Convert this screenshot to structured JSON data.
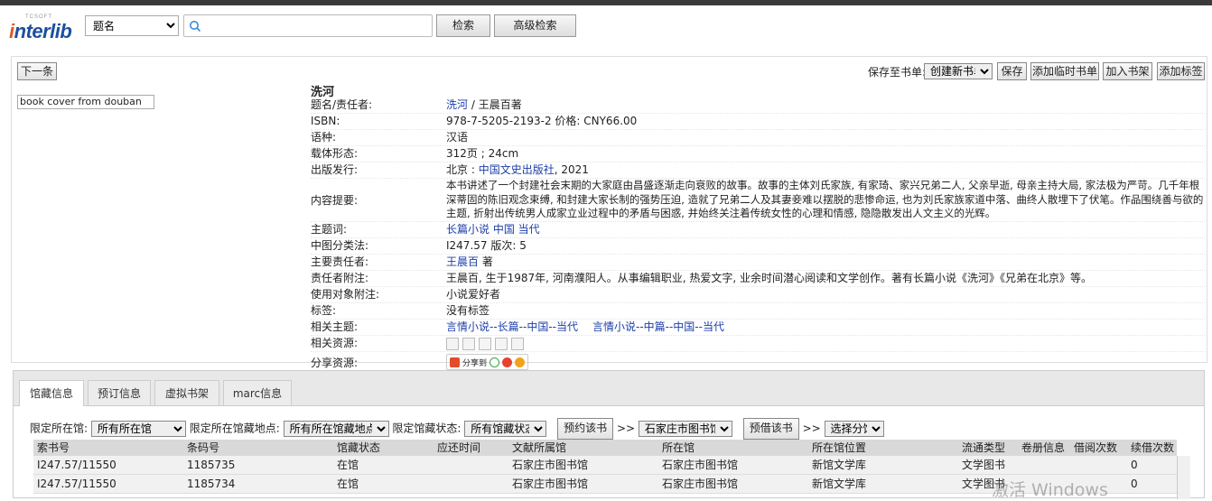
{
  "logo": {
    "tcsoft": "TCSOFT",
    "text_i": "i",
    "text_rest": "nterlib"
  },
  "search": {
    "field": "题名",
    "button": "检索",
    "advanced": "高级检索"
  },
  "toolbar": {
    "next": "下一条",
    "save_to_label": "保存至书单:",
    "booklist_select": "创建新书单",
    "save": "保存",
    "add_temp": "添加临时书单",
    "add_shelf": "加入书架",
    "add_tag": "添加标签"
  },
  "cover_alt": "book cover from douban",
  "book": {
    "title": "洗河",
    "fields": [
      {
        "label": "题名/责任者:",
        "link": "洗河",
        "text": " / 王晨百著"
      },
      {
        "label": "ISBN:",
        "text": "978-7-5205-2193-2 价格:   CNY66.00"
      },
      {
        "label": "语种:",
        "text": "汉语"
      },
      {
        "label": "载体形态:",
        "text": "312页 ; 24cm"
      },
      {
        "label": "出版发行:",
        "pre": "北京 : ",
        "link": "中国文史出版社",
        "text": ", 2021"
      },
      {
        "label": "内容提要:",
        "text": "本书讲述了一个封建社会末期的大家庭由昌盛逐渐走向衰败的故事。故事的主体刘氏家族, 有家琦、家兴兄弟二人, 父亲早逝, 母亲主持大局, 家法极为严苛。几千年根深蒂固的陈旧观念束缚, 和封建大家长制的强势压迫, 造就了兄弟二人及其妻妾难以摆脱的悲惨命运, 也为刘氏家族家道中落、曲终人散埋下了伏笔。作品围绕善与欲的主题, 折射出传统男人成家立业过程中的矛盾与困惑, 并始终关注着传统女性的心理和情感, 隐隐散发出人文主义的光辉。"
      },
      {
        "label": "主题词:",
        "link": "长篇小说 中国 当代"
      },
      {
        "label": "中图分类法:",
        "text": "I247.57 版次:   5"
      },
      {
        "label": "主要责任者:",
        "link": "王晨百",
        "text": " 著"
      },
      {
        "label": "责任者附注:",
        "text": "王晨百, 生于1987年, 河南濮阳人。从事编辑职业, 热爱文字, 业余时间潜心阅读和文学创作。著有长篇小说《洗河》《兄弟在北京》等。"
      },
      {
        "label": "使用对象附注:",
        "text": "小说爱好者"
      },
      {
        "label": "标签:",
        "text": "没有标签"
      },
      {
        "label": "相关主题:",
        "link": "言情小说--长篇--中国--当代",
        "link2": "言情小说--中篇--中国--当代"
      },
      {
        "label": "相关资源:",
        "text": ""
      },
      {
        "label": "分享资源:",
        "share": "分享到"
      }
    ]
  },
  "tabs": [
    {
      "label": "馆藏信息"
    },
    {
      "label": "预订信息"
    },
    {
      "label": "虚拟书架"
    },
    {
      "label": "marc信息"
    }
  ],
  "filters": {
    "lib_label": "限定所在馆:",
    "lib_value": "所有所在馆",
    "loc_label": "限定所在馆藏地点:",
    "loc_value": "所有所在馆藏地点",
    "status_label": "限定馆藏状态:",
    "status_value": "所有馆藏状态",
    "reserve_btn": "预约该书",
    "arrow1": ">>",
    "lib_select": "石家庄市图书馆",
    "borrow_btn": "预借该书",
    "arrow2": ">>",
    "branch_select": "选择分馆"
  },
  "table": {
    "headers": [
      "索书号",
      "条码号",
      "馆藏状态",
      "应还时间",
      "文献所属馆",
      "所在馆",
      "所在馆位置",
      "流通类型",
      "卷册信息",
      "借阅次数",
      "续借次数"
    ],
    "rows": [
      [
        "I247.57/11550",
        "1185735",
        "在馆",
        "",
        "石家庄市图书馆",
        "石家庄市图书馆",
        "新馆文学库",
        "文学图书",
        "",
        "",
        "0"
      ],
      [
        "I247.57/11550",
        "1185734",
        "在馆",
        "",
        "石家庄市图书馆",
        "石家庄市图书馆",
        "新馆文学库",
        "文学图书",
        "",
        "",
        "0"
      ]
    ]
  },
  "watermark": "激活 Windows"
}
